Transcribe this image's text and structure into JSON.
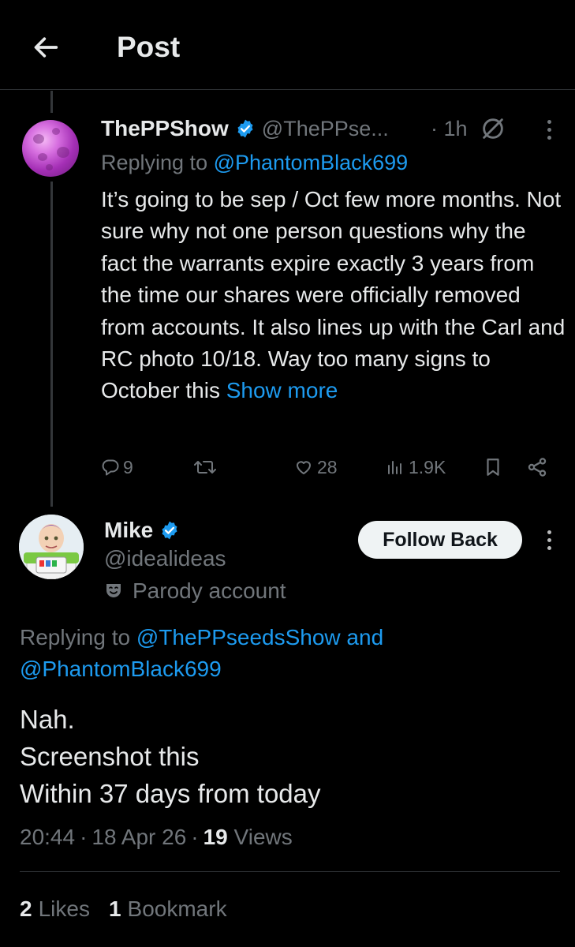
{
  "header": {
    "title": "Post"
  },
  "parent_tweet": {
    "display_name": "ThePPShow",
    "handle": "@ThePPse...",
    "time": "· 1h",
    "replying_prefix": "Replying to ",
    "replying_to": "@PhantomBlack699",
    "body": "It’s going to be sep / Oct few more months. Not sure why not one person questions why the fact the warrants expire exactly 3 years from the time our shares were officially removed from accounts. It also lines up with the Carl and RC photo 10/18. Way too many signs to October this ",
    "show_more": "Show more",
    "replies": "9",
    "likes": "28",
    "views": "1.9K"
  },
  "main_tweet": {
    "display_name": "Mike",
    "handle": "@idealideas",
    "parody_label": "Parody account",
    "follow_button": "Follow Back",
    "replying_prefix": "Replying to ",
    "replying_to_1": "@ThePPseedsShow",
    "replying_and": " and ",
    "replying_to_2": "@PhantomBlack699",
    "body_lines": [
      "Nah.",
      "Screenshot this",
      "Within 37 days from today"
    ],
    "time": "20:44",
    "date": "18 Apr 26",
    "views_count": "19",
    "views_label": "Views",
    "likes_count": "2",
    "likes_label": "Likes",
    "bookmarks_count": "1",
    "bookmarks_label": "Bookmark"
  },
  "colors": {
    "background": "#000000",
    "text": "#e7e9ea",
    "muted": "#71767b",
    "link": "#1d9bf0",
    "verified": "#1d9bf0"
  }
}
